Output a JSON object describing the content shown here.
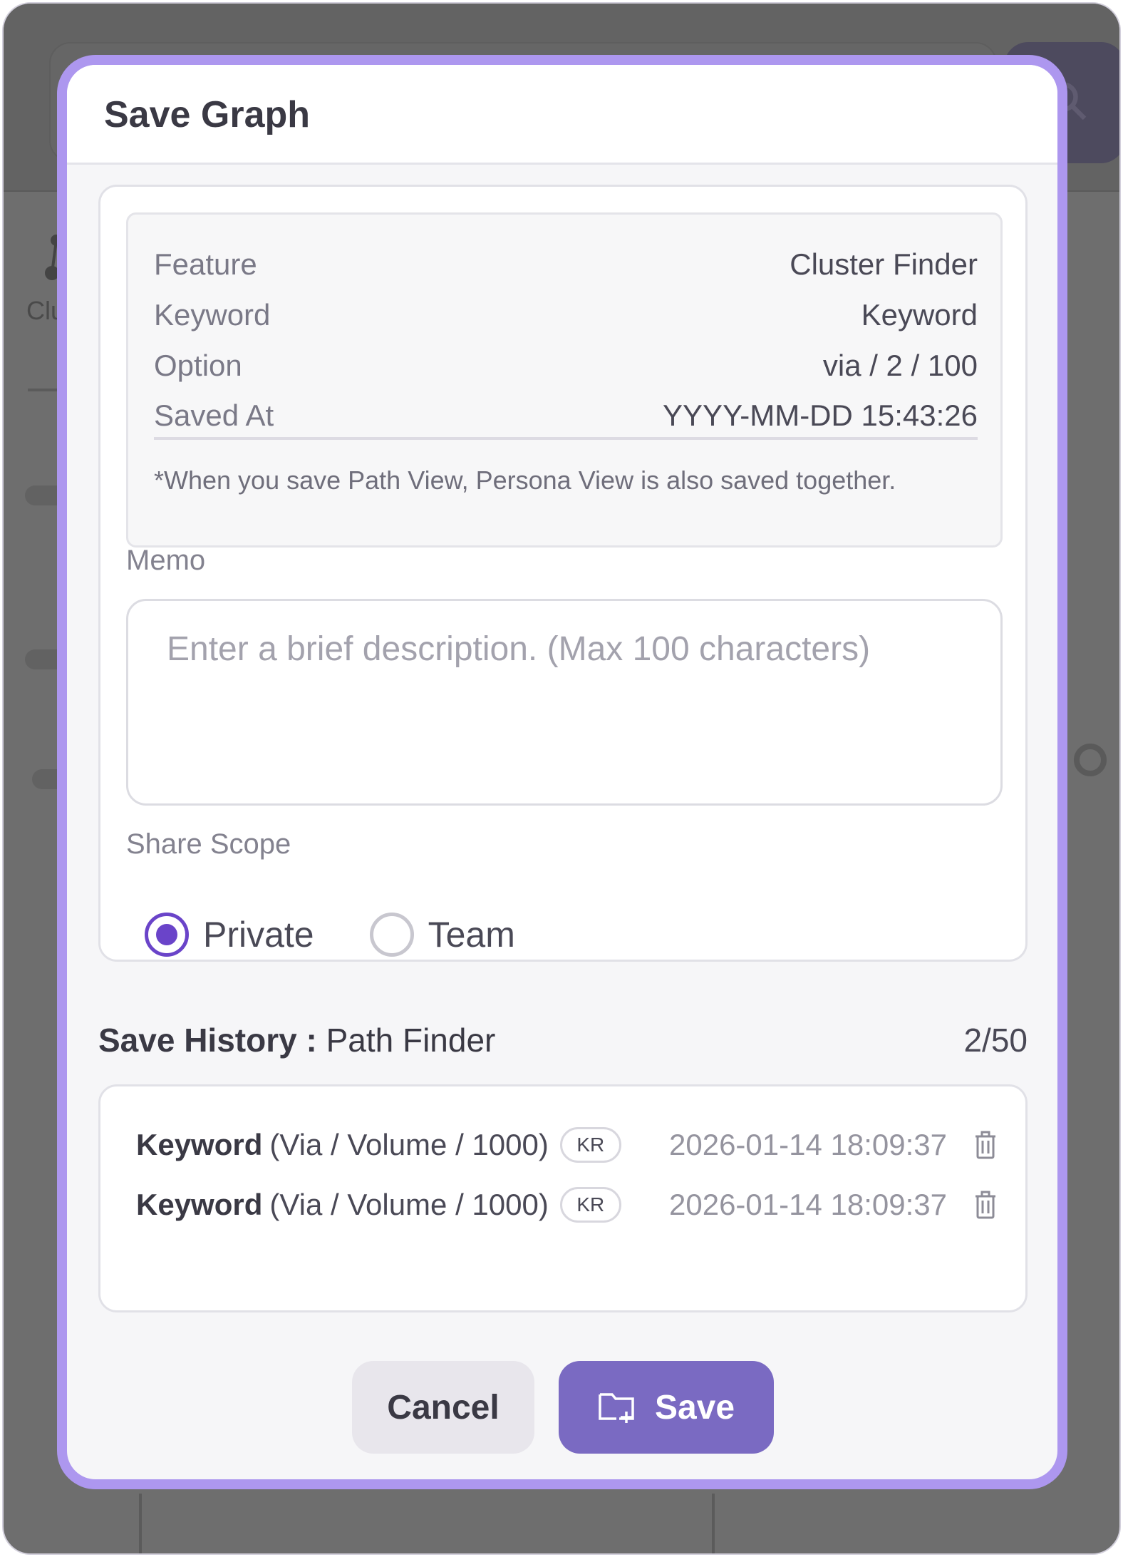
{
  "background": {
    "sidebar_label": "Clu"
  },
  "modal": {
    "title": "Save Graph",
    "info": {
      "rows": [
        {
          "label": "Feature",
          "value": "Cluster Finder"
        },
        {
          "label": "Keyword",
          "value": "Keyword"
        },
        {
          "label": "Option",
          "value": "via / 2 / 100"
        },
        {
          "label": "Saved At",
          "value": "YYYY-MM-DD 15:43:26"
        }
      ],
      "note": "*When you save Path View, Persona View is also saved together."
    },
    "memo": {
      "label": "Memo",
      "placeholder": "Enter a brief description. (Max 100 characters)",
      "value": ""
    },
    "share_scope": {
      "label": "Share Scope",
      "options": [
        {
          "label": "Private",
          "selected": true
        },
        {
          "label": "Team",
          "selected": false
        }
      ]
    },
    "history": {
      "title_bold": "Save History :",
      "title_feature": "Path Finder",
      "count": "2/50",
      "items": [
        {
          "name": "Keyword",
          "options": "(Via / Volume / 1000)",
          "badge": "KR",
          "date": "2026-01-14 18:09:37"
        },
        {
          "name": "Keyword",
          "options": "(Via / Volume / 1000)",
          "badge": "KR",
          "date": "2026-01-14 18:09:37"
        }
      ]
    },
    "buttons": {
      "cancel": "Cancel",
      "save": "Save"
    }
  },
  "colors": {
    "accent": "#6a44c9",
    "modal_border": "#ad97ef",
    "save_button": "#7a6ac2",
    "overlay": "#6e6e6e"
  },
  "icons": {
    "save": "folder-plus-icon",
    "delete": "trash-icon",
    "search": "search-icon"
  }
}
